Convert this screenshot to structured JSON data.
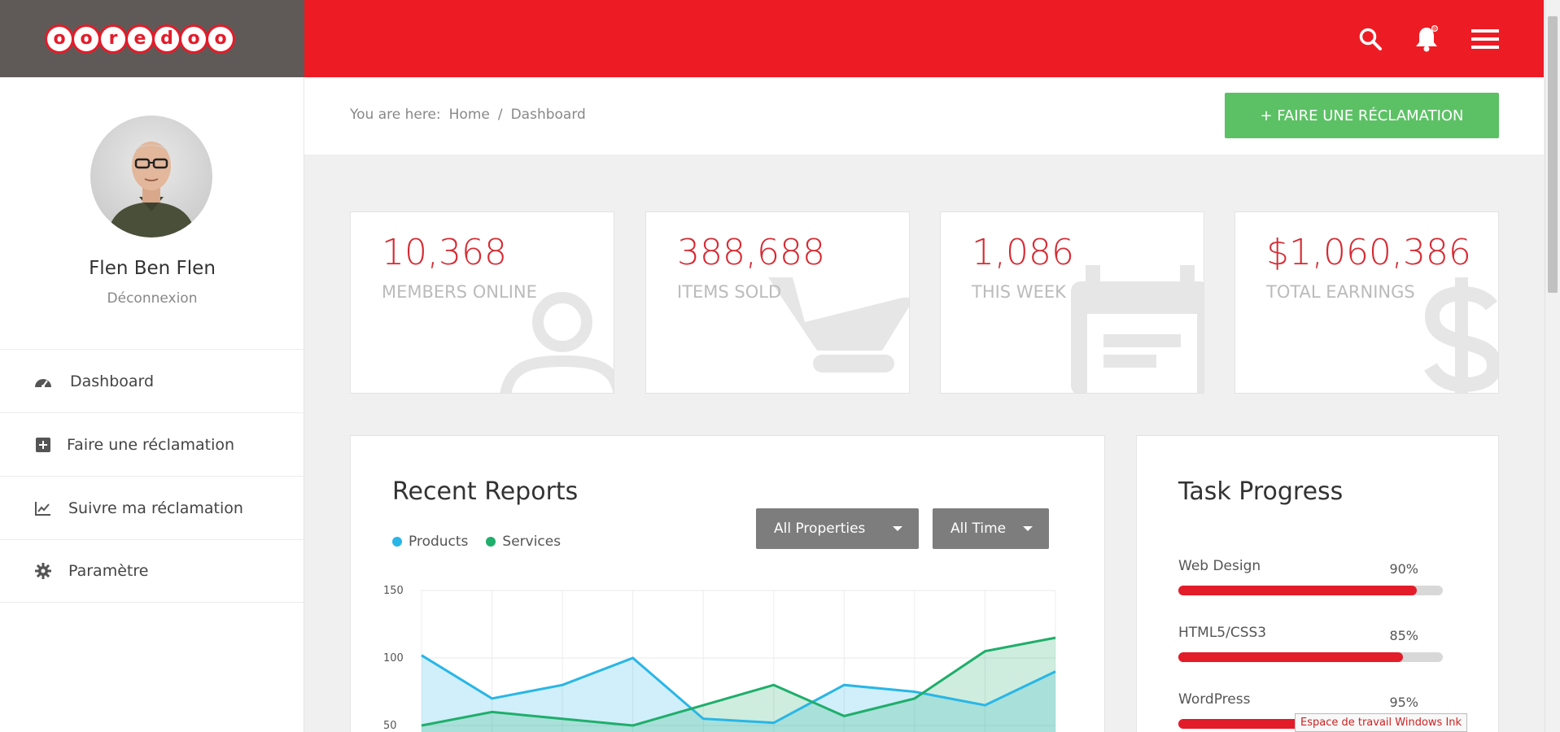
{
  "header": {
    "logo_text": "ooredoo",
    "logo_letters": [
      "o",
      "o",
      "r",
      "e",
      "d",
      "o",
      "o"
    ],
    "icons": [
      "search-icon",
      "bell-icon",
      "hamburger-menu-icon"
    ]
  },
  "sidebar": {
    "user_name": "Flen Ben Flen",
    "logout_label": "Déconnexion",
    "items": [
      {
        "label": "Dashboard",
        "icon": "dashboard-gauge-icon"
      },
      {
        "label": "Faire une réclamation",
        "icon": "plus-square-icon"
      },
      {
        "label": "Suivre ma réclamation",
        "icon": "line-chart-icon"
      },
      {
        "label": "Paramètre",
        "icon": "gear-icon"
      }
    ]
  },
  "breadcrumb": {
    "prefix": "You are here:",
    "home": "Home",
    "separator": "/",
    "current": "Dashboard"
  },
  "cta": {
    "label": "+ FAIRE UNE RÉCLAMATION"
  },
  "stats": [
    {
      "value": "10,368",
      "label": "MEMBERS ONLINE",
      "icon": "user-icon"
    },
    {
      "value": "388,688",
      "label": "ITEMS SOLD",
      "icon": "cart-icon"
    },
    {
      "value": "1,086",
      "label": "THIS WEEK",
      "icon": "calendar-icon"
    },
    {
      "value": "$1,060,386",
      "label": "TOTAL EARNINGS",
      "icon": "dollar-icon"
    }
  ],
  "reports": {
    "title": "Recent Reports",
    "filter_properties": "All Properties",
    "filter_time": "All Time"
  },
  "chart_data": {
    "type": "area",
    "title": "Recent Reports",
    "xlabel": "",
    "ylabel": "",
    "ylim": [
      0,
      150
    ],
    "yticks_visible": [
      "150",
      "100",
      "50"
    ],
    "grid": true,
    "legend_position": "top-left",
    "x": [
      0,
      1,
      2,
      3,
      4,
      5,
      6,
      7,
      8,
      9
    ],
    "series": [
      {
        "name": "Products",
        "color": "#29b6e6",
        "values": [
          102,
          70,
          80,
          100,
          55,
          52,
          80,
          75,
          65,
          90
        ]
      },
      {
        "name": "Services",
        "color": "#1fae6b",
        "values": [
          50,
          60,
          55,
          50,
          65,
          80,
          57,
          70,
          105,
          115
        ]
      }
    ]
  },
  "tasks": {
    "title": "Task Progress",
    "items": [
      {
        "name": "Web Design",
        "percent_label": "90%",
        "value": 0.9
      },
      {
        "name": "HTML5/CSS3",
        "percent_label": "85%",
        "value": 0.85
      },
      {
        "name": "WordPress",
        "percent_label": "95%",
        "value": 0.95
      }
    ]
  },
  "tooltip": {
    "text": "Espace de travail Windows Ink"
  },
  "colors": {
    "brand_red": "#ed1c24",
    "brand_dark": "#5f5a57",
    "stat_red": "#d62b33",
    "cta_green": "#5cc165",
    "dropdown_gray": "#7d7d7d"
  }
}
